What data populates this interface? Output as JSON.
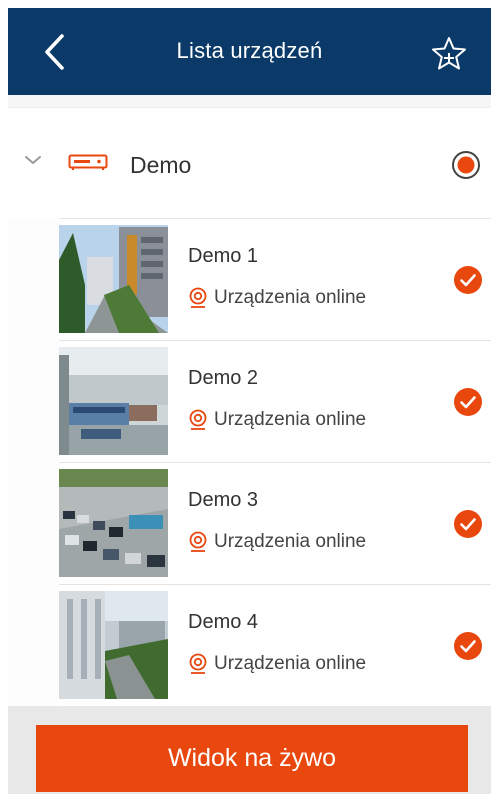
{
  "header": {
    "title": "Lista urządzeń",
    "back_icon": "back-arrow-icon",
    "favorite_icon": "star-add-icon",
    "background": "#0b3a68"
  },
  "group": {
    "name": "Demo",
    "icon": "dvr-recorder-icon",
    "expanded": true,
    "selected": true
  },
  "devices": [
    {
      "name": "Demo 1",
      "status": "Urządzenia online",
      "checked": true
    },
    {
      "name": "Demo 2",
      "status": "Urządzenia online",
      "checked": true
    },
    {
      "name": "Demo 3",
      "status": "Urządzenia online",
      "checked": true
    },
    {
      "name": "Demo 4",
      "status": "Urządzenia online",
      "checked": true
    }
  ],
  "footer": {
    "live_view_label": "Widok na żywo"
  },
  "colors": {
    "accent": "#e8470e",
    "header": "#0b3a68"
  }
}
